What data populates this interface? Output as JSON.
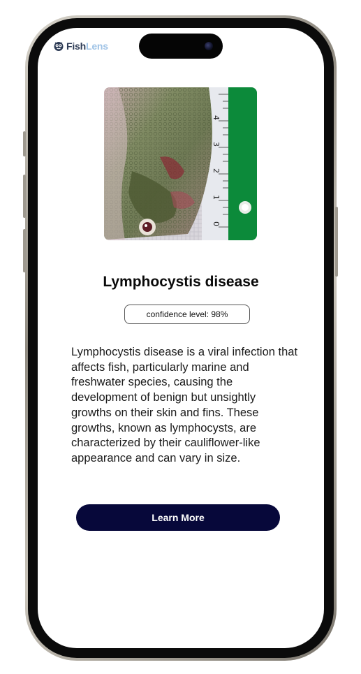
{
  "app": {
    "name_part1": "Fish",
    "name_part2": "Lens",
    "logo_icon": "fish-mascot-icon"
  },
  "result": {
    "image_subject": "fish-with-lymphocystis-photo",
    "disease_name": "Lymphocystis disease",
    "confidence_label": "confidence level: 98%",
    "description": "Lymphocystis disease is a viral infection that affects fish, particularly marine and freshwater species, causing the development of benign but unsightly growths on their skin and fins. These growths, known as lymphocysts, are characterized by their cauliflower-like appearance and can vary in size."
  },
  "actions": {
    "learn_more_label": "Learn More"
  },
  "colors": {
    "button_bg": "#07083a",
    "logo_dark": "#2d3b55",
    "logo_light": "#9fc3e6",
    "ruler_green": "#0c8a3a"
  },
  "photo": {
    "ruler_numbers": [
      "4",
      "3",
      "2",
      "1",
      "0"
    ]
  }
}
